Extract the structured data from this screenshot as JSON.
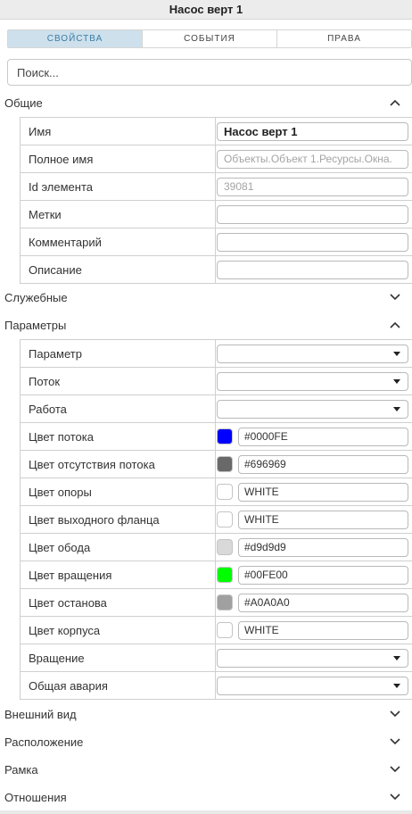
{
  "title": "Насос верт 1",
  "tabs": [
    {
      "label": "СВОЙСТВА",
      "active": true
    },
    {
      "label": "СОБЫТИЯ",
      "active": false
    },
    {
      "label": "ПРАВА",
      "active": false
    }
  ],
  "search": {
    "placeholder": "Поиск..."
  },
  "sections": {
    "general": {
      "title": "Общие",
      "expanded": true,
      "chevron": "chevron-up-icon"
    },
    "service": {
      "title": "Служебные",
      "expanded": false,
      "chevron": "chevron-down-icon"
    },
    "params": {
      "title": "Параметры",
      "expanded": true,
      "chevron": "chevron-up-icon"
    },
    "appearance": {
      "title": "Внешний вид",
      "expanded": false,
      "chevron": "chevron-down-icon"
    },
    "placement": {
      "title": "Расположение",
      "expanded": false,
      "chevron": "chevron-down-icon"
    },
    "frame": {
      "title": "Рамка",
      "expanded": false,
      "chevron": "chevron-down-icon"
    },
    "relations": {
      "title": "Отношения",
      "expanded": false,
      "chevron": "chevron-down-icon"
    }
  },
  "general": {
    "name": {
      "label": "Имя",
      "value": "Насос верт 1"
    },
    "full_name": {
      "label": "Полное имя",
      "value": "Объекты.Объект 1.Ресурсы.Окна."
    },
    "element_id": {
      "label": "Id элемента",
      "value": "39081"
    },
    "tags": {
      "label": "Метки",
      "value": ""
    },
    "comment": {
      "label": "Комментарий",
      "value": ""
    },
    "description": {
      "label": "Описание",
      "value": ""
    }
  },
  "params": {
    "parameter": {
      "label": "Параметр",
      "value": ""
    },
    "flow": {
      "label": "Поток",
      "value": ""
    },
    "work": {
      "label": "Работа",
      "value": ""
    },
    "flow_color": {
      "label": "Цвет потока",
      "value": "#0000FE",
      "swatch": "#0000fe"
    },
    "no_flow_color": {
      "label": "Цвет отсутствия потока",
      "value": "#696969",
      "swatch": "#696969"
    },
    "support_color": {
      "label": "Цвет опоры",
      "value": "WHITE",
      "swatch": "#ffffff"
    },
    "outlet_flange_color": {
      "label": "Цвет выходного фланца",
      "value": "WHITE",
      "swatch": "#ffffff"
    },
    "rim_color": {
      "label": "Цвет обода",
      "value": "#d9d9d9",
      "swatch": "#d9d9d9"
    },
    "rotation_color": {
      "label": "Цвет вращения",
      "value": "#00FE00",
      "swatch": "#00fe00"
    },
    "stop_color": {
      "label": "Цвет останова",
      "value": "#A0A0A0",
      "swatch": "#a0a0a0"
    },
    "body_color": {
      "label": "Цвет корпуса",
      "value": "WHITE",
      "swatch": "#ffffff"
    },
    "rotation": {
      "label": "Вращение",
      "value": ""
    },
    "general_alarm": {
      "label": "Общая авария",
      "value": ""
    }
  }
}
